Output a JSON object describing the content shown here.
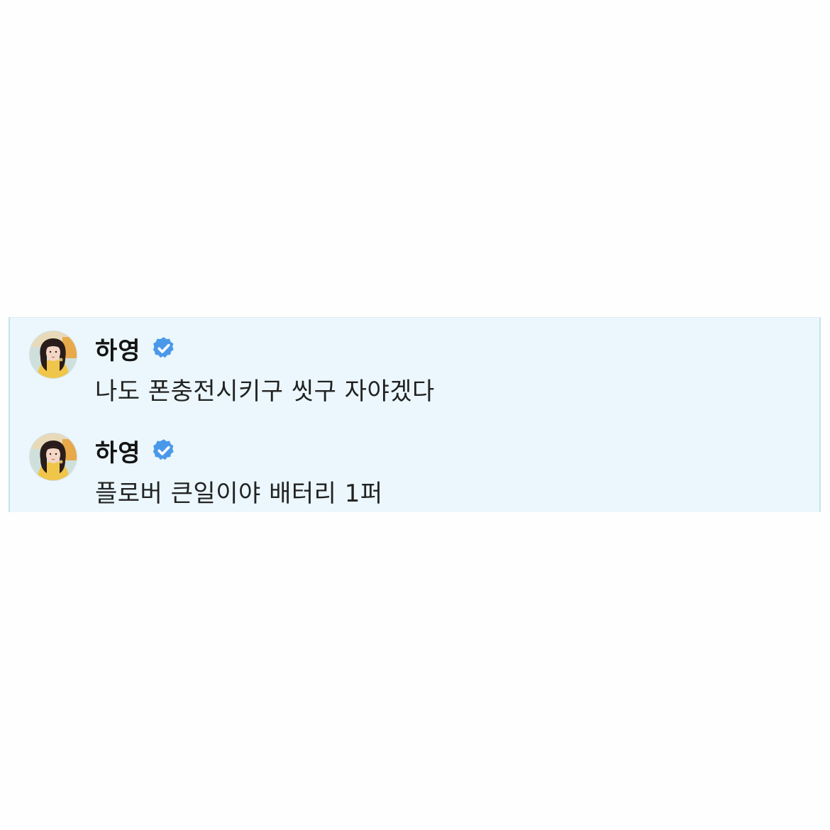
{
  "colors": {
    "panel_background": "#ebf7fc",
    "verified_badge": "#4a99e9",
    "name_text": "#141414",
    "message_text": "#222222"
  },
  "messages": [
    {
      "author": "하영",
      "verified": true,
      "avatar_icon": "profile-photo",
      "badge_icon": "verified-badge-icon",
      "text": "나도 폰충전시키구 씻구 자야겠다"
    },
    {
      "author": "하영",
      "verified": true,
      "avatar_icon": "profile-photo",
      "badge_icon": "verified-badge-icon",
      "text": "플로버 큰일이야 배터리 1퍼"
    }
  ]
}
